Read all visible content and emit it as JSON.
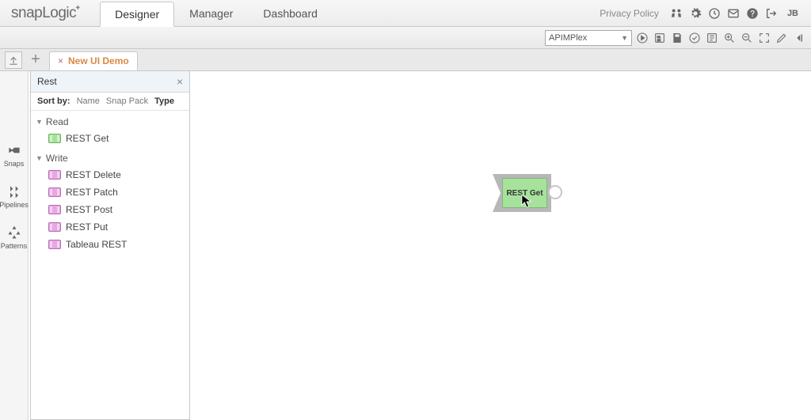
{
  "brand": {
    "part1": "snap",
    "part2": "Logic"
  },
  "nav": {
    "tabs": [
      {
        "label": "Designer",
        "active": true
      },
      {
        "label": "Manager",
        "active": false
      },
      {
        "label": "Dashboard",
        "active": false
      }
    ]
  },
  "header_right": {
    "privacy": "Privacy Policy",
    "user": "JB"
  },
  "pipeline_dropdown": {
    "value": "APIMPlex"
  },
  "document_tabs": {
    "tabs": [
      {
        "name": "New UI Demo"
      }
    ]
  },
  "siderail": {
    "items": [
      {
        "label": "Snaps"
      },
      {
        "label": "Pipelines"
      },
      {
        "label": "Patterns"
      }
    ]
  },
  "snap_panel": {
    "search_value": "Rest",
    "sort_label": "Sort by:",
    "sort_options": [
      {
        "label": "Name",
        "active": false
      },
      {
        "label": "Snap Pack",
        "active": false
      },
      {
        "label": "Type",
        "active": true
      }
    ],
    "groups": [
      {
        "name": "Read",
        "kind": "read",
        "items": [
          {
            "label": "REST Get"
          }
        ]
      },
      {
        "name": "Write",
        "kind": "write",
        "items": [
          {
            "label": "REST Delete"
          },
          {
            "label": "REST Patch"
          },
          {
            "label": "REST Post"
          },
          {
            "label": "REST Put"
          },
          {
            "label": "Tableau REST"
          }
        ]
      }
    ]
  },
  "canvas": {
    "nodes": [
      {
        "label": "REST Get"
      }
    ]
  }
}
